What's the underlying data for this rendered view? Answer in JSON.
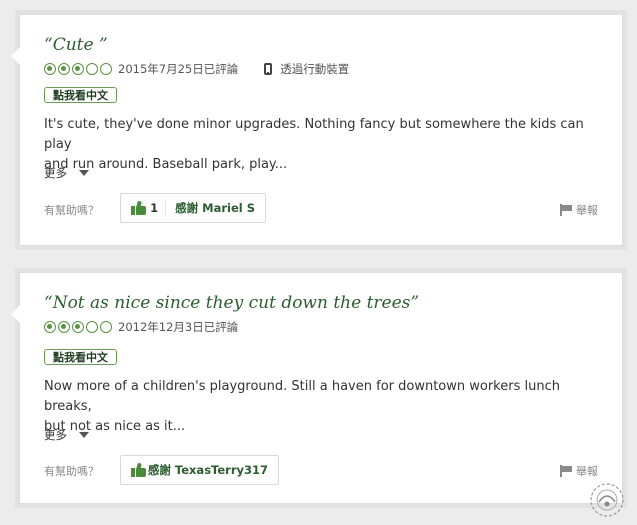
{
  "reviews": [
    {
      "title": "“Cute ”",
      "rating": 3,
      "max_rating": 5,
      "date": "2015年7月25日已評論",
      "device_text": "透過行動裝置",
      "translate_label": "點我看中文",
      "body_line1": "It's cute, they've done minor upgrades. Nothing fancy but somewhere the kids can play",
      "body_line2": "and run around. Baseball park, play...",
      "more_label": "更多",
      "helpful_label": "有幫助嗎？",
      "thanks_count": "1",
      "thanks_label": "感謝 Mariel S",
      "report_label": "舉報"
    },
    {
      "title": "“Not as nice since they cut down the trees”",
      "rating": 3,
      "max_rating": 5,
      "date": "2012年12月3日已評論",
      "translate_label": "點我看中文",
      "body_line1": "Now more of a children's playground. Still a haven for downtown workers lunch breaks,",
      "body_line2": "but not as nice as it...",
      "more_label": "更多",
      "helpful_label": "有幫助嗎？",
      "thanks_label": "感謝 TexasTerry317",
      "report_label": "舉報"
    }
  ],
  "colors": {
    "accent_green": "#589442",
    "title_green": "#2b5d2e",
    "background": "#ececec"
  },
  "icons": [
    "phone-icon",
    "thumbs-up-icon",
    "flag-icon",
    "chevron-down-icon",
    "rating-bubble-icon"
  ]
}
